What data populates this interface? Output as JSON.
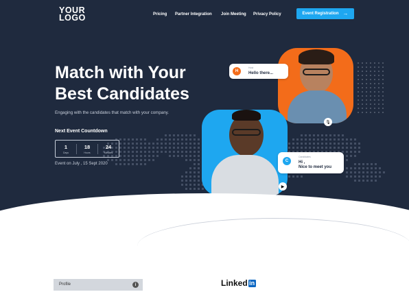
{
  "header": {
    "logo_line1": "YOUR",
    "logo_line2": "LOGO",
    "nav": [
      "Pricing",
      "Partner Integration",
      "Join Meeting",
      "Privacy Policy"
    ],
    "cta_label": "Event Registration",
    "cta_icon": "arrow-right-icon"
  },
  "hero": {
    "headline_line1": "Match with Your",
    "headline_line2": "Best Candidates",
    "subtitle": "Engaging with the candidates that match with your company.",
    "countdown_title": "Next Event Countdown",
    "countdown": [
      {
        "value": "1",
        "label": "Days"
      },
      {
        "value": "18",
        "label": "Hours"
      },
      {
        "value": "24",
        "label": "Minutes"
      }
    ],
    "event_date": "Event on July , 15 Sept 2020"
  },
  "chat": {
    "host": {
      "badge": "H",
      "who": "Host",
      "message": "Hello there..."
    },
    "candidate": {
      "badge": "C",
      "who": "Candidates",
      "line1": "Hi ,",
      "line2": "Nice to meet you"
    }
  },
  "footer": {
    "profile_label": "Profile",
    "info_icon": "info-icon",
    "linkedin_text": "Linked",
    "linkedin_in": "in"
  },
  "colors": {
    "hero_bg": "#1f2a3e",
    "accent_blue": "#1ea7f0",
    "accent_orange": "#f36c1a"
  }
}
